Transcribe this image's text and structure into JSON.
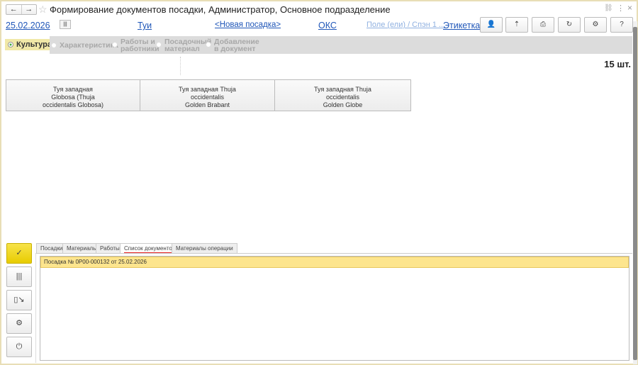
{
  "window": {
    "title": "Формирование документов посадки, Администратор, Основное подразделение",
    "back": "←",
    "forward": "→",
    "star": "☆",
    "link_icon": "🔗",
    "more": "⋮",
    "close": "×"
  },
  "header": {
    "date": "25.02.2026",
    "culture": "Туи",
    "document": "<Новая посадка>",
    "oks": "ОКС",
    "field": "Поле (ели) / Спэн 1 ...",
    "label": "Этикетка"
  },
  "toolbar": [
    "user-icon",
    "transfer-icon",
    "print-icon",
    "refresh-icon",
    "settings-icon",
    "help-icon"
  ],
  "toolbar_glyphs": [
    "👤",
    "⇡",
    "⎙",
    "↻",
    "⚙",
    "?"
  ],
  "steps": {
    "active": "Культура",
    "items": [
      "Характеристика",
      "Работы и работники",
      "Посадочный материал",
      "Добавление в документ"
    ]
  },
  "count": "15 шт.",
  "tiles": [
    {
      "line1": "Туя западная",
      "line2": "Globosa (Thuja",
      "line3": "occidentalis Globosa)"
    },
    {
      "line1": "Туя западная Thuja",
      "line2": "occidentalis",
      "line3": "Golden Brabant"
    },
    {
      "line1": "Туя западная Thuja",
      "line2": "occidentalis",
      "line3": "Golden Globe"
    }
  ],
  "side_buttons": [
    "✓",
    "|||",
    "▯↘",
    "⚙",
    "⏻"
  ],
  "tabs": [
    "Посадки",
    "Материалы",
    "Работы",
    "Список документов",
    "Материалы операции"
  ],
  "active_tab": "Список документов",
  "documents": [
    {
      "text": "Посадка № 0Р00-000132 от 25.02.2026"
    }
  ],
  "colors": {
    "accent": "#f5de3a",
    "selected_row": "#fde58e",
    "tab_underline": "#e52020",
    "link": "#1f56b8"
  }
}
